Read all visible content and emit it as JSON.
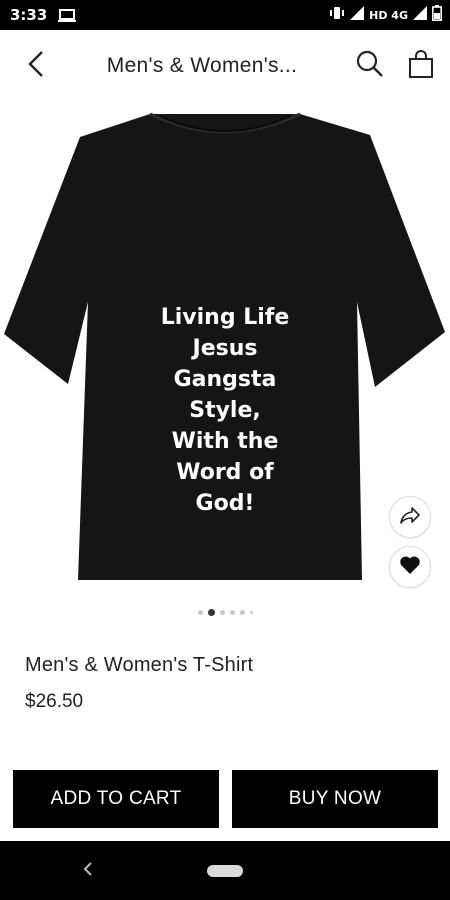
{
  "status_bar": {
    "time": "3:33",
    "network_label": "HD 4G",
    "icons": [
      "laptop-icon",
      "vibrate-icon",
      "signal-icon",
      "battery-icon"
    ]
  },
  "header": {
    "title": "Men's & Women's...",
    "icons": [
      "back-arrow-icon",
      "search-icon",
      "shopping-bag-icon"
    ]
  },
  "product": {
    "image_text_lines": [
      "Living Life",
      "Jesus",
      "Gangsta",
      "Style,",
      "With the",
      "Word of",
      "God!"
    ],
    "name": "Men's & Women's T-Shirt",
    "price": "$26.50",
    "image_count": 6,
    "active_image_index": 1
  },
  "actions": {
    "add_to_cart_label": "ADD TO CART",
    "buy_now_label": "BUY NOW",
    "share_icon": "share-icon",
    "favorite_icon": "heart-icon"
  },
  "colors": {
    "accent": "#000000",
    "background": "#ffffff",
    "shirt": "#151515"
  }
}
